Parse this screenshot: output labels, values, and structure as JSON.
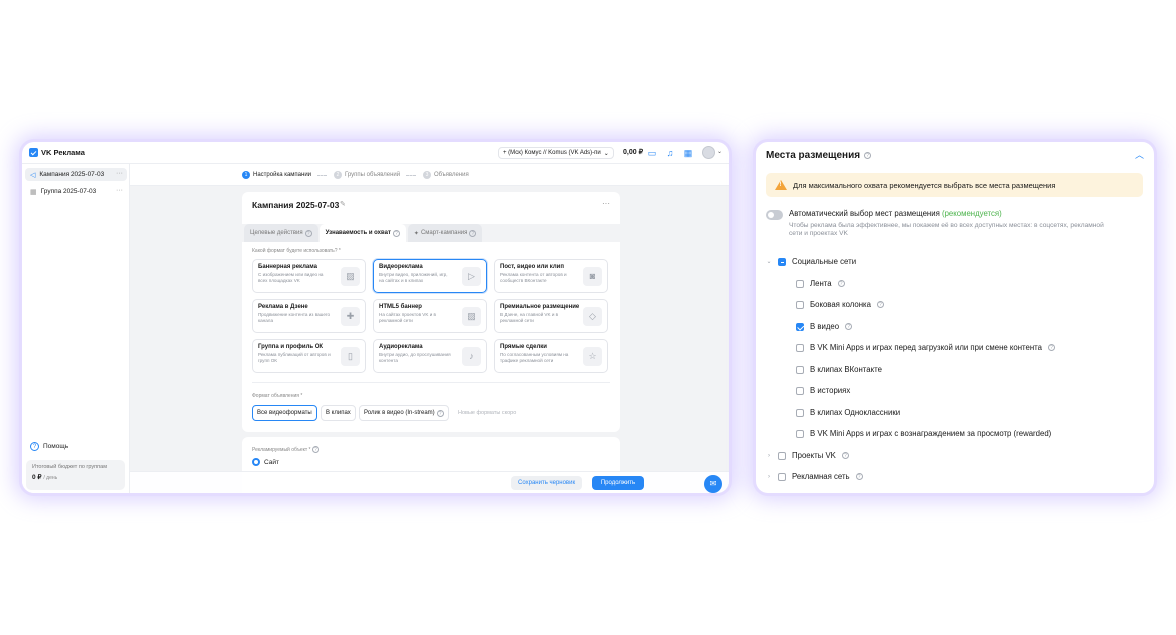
{
  "app": {
    "name": "VK Реклама",
    "account": "+ (Мск) Комус // Komus (VK Ads)-пи",
    "balance": "0,00 ₽"
  },
  "sidebar": {
    "items": [
      {
        "label": "Кампания 2025-07-03"
      },
      {
        "label": "Группа 2025-07-03"
      }
    ],
    "help": "Помощь",
    "budget_label": "Итоговый бюджет по группам",
    "budget_value": "0 ₽",
    "budget_unit": "/ день"
  },
  "stepper": {
    "steps": [
      "Настройка кампании",
      "Группы объявлений",
      "Объявления"
    ]
  },
  "campaign": {
    "title": "Кампания 2025-07-03",
    "tabs": [
      "Целевые действия",
      "Узнаваемость и охват",
      "Смарт-кампания"
    ],
    "format_question": "Какой формат будете использовать? *",
    "formats": [
      {
        "title": "Баннерная реклама",
        "desc": "С изображением или видео на всех площадках VK",
        "icon": "image-icon"
      },
      {
        "title": "Видеореклама",
        "desc": "Внутри видео, приложений, игр, на сайтах и в клипах",
        "icon": "play-icon"
      },
      {
        "title": "Пост, видео или клип",
        "desc": "Реклама контента от авторов и сообществ ВКонтакте",
        "icon": "vk-icon"
      },
      {
        "title": "Реклама в Дзене",
        "desc": "Продвижение контента из вашего канала",
        "icon": "plus-icon"
      },
      {
        "title": "HTML5 баннер",
        "desc": "На сайтах проектов VK и в рекламной сети",
        "icon": "image-icon"
      },
      {
        "title": "Премиальное размещение",
        "desc": "В Дзене, на главной VK и в рекламной сети",
        "icon": "diamond-icon"
      },
      {
        "title": "Группа и профиль ОК",
        "desc": "Реклама публикаций от авторов и групп ОК",
        "icon": "ok-icon"
      },
      {
        "title": "Аудиореклама",
        "desc": "Внутри аудио, до прослушивания контента",
        "icon": "headphones-icon"
      },
      {
        "title": "Прямые сделки",
        "desc": "По согласованным условиям на трафике рекламной сети",
        "icon": "star-icon"
      }
    ],
    "ad_format_label": "Формат объявления *",
    "ad_formats": [
      "Все видеоформаты",
      "В клипах",
      "Ролик в видео (In-stream)"
    ],
    "new_formats": "Новые форматы скоро",
    "object_label": "Рекламируемый объект *",
    "object_selected": "Сайт",
    "save_draft": "Сохранить черновик",
    "continue": "Продолжить"
  },
  "placements": {
    "title": "Места размещения",
    "alert": "Для максимального охвата рекомендуется выбрать все места размещения",
    "auto_label": "Автоматический выбор мест размещения",
    "auto_rec": "(рекомендуется)",
    "auto_desc": "Чтобы реклама была эффективнее, мы покажем её во всех доступных местах: в соцсетях, рекламной сети и проектах VK",
    "groups": [
      {
        "label": "Социальные сети",
        "state": "indeterminate",
        "expanded": true
      },
      {
        "label": "Проекты VK",
        "state": "unchecked",
        "expanded": false
      },
      {
        "label": "Рекламная сеть",
        "state": "unchecked",
        "expanded": false
      }
    ],
    "social_items": [
      {
        "label": "Лента",
        "checked": false,
        "help": true
      },
      {
        "label": "Боковая колонка",
        "checked": false,
        "help": true
      },
      {
        "label": "В видео",
        "checked": true,
        "help": true
      },
      {
        "label": "В VK Mini Apps и играх перед загрузкой или при смене контента",
        "checked": false,
        "help": true
      },
      {
        "label": "В клипах ВКонтакте",
        "checked": false,
        "help": false
      },
      {
        "label": "В историях",
        "checked": false,
        "help": false
      },
      {
        "label": "В клипах Одноклассники",
        "checked": false,
        "help": false
      },
      {
        "label": "В VK Mini Apps и играх с вознаграждением за просмотр (rewarded)",
        "checked": false,
        "help": false
      }
    ]
  },
  "colors": {
    "accent": "#2787f5",
    "glow": "#b8a6ff",
    "alert_bg": "#fdf3dd",
    "success": "#4bb34b"
  }
}
